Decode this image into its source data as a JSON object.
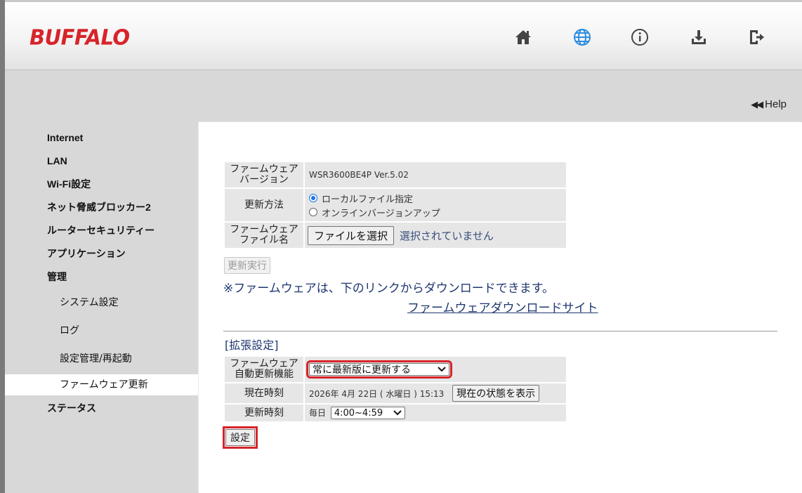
{
  "header": {
    "logo": "BUFFALO",
    "icons": [
      "home-icon",
      "globe-icon",
      "info-icon",
      "download-icon",
      "logout-icon"
    ],
    "accent_color": "#d7242a",
    "globe_color": "#2b8de0"
  },
  "help": {
    "arrows": "◀◀",
    "label": "Help"
  },
  "nav": {
    "internet": "Internet",
    "lan": "LAN",
    "wifi": "Wi-Fi設定",
    "net_blocker": "ネット脅威ブロッカー2",
    "router_security": "ルーターセキュリティー",
    "application": "アプリケーション",
    "admin": "管理",
    "system": "システム設定",
    "log": "ログ",
    "config_restart": "設定管理/再起動",
    "firmware_update": "ファームウェア更新",
    "status": "ステータス"
  },
  "firmware": {
    "version_label_1": "ファームウェア",
    "version_label_2": "バージョン",
    "version_value": "WSR3600BE4P Ver.5.02",
    "method_label": "更新方法",
    "method_local": "ローカルファイル指定",
    "method_online": "オンラインバージョンアップ",
    "file_label_1": "ファームウェア",
    "file_label_2": "ファイル名",
    "choose_file": "ファイルを選択",
    "no_file": "選択されていません",
    "execute": "更新実行",
    "note": "※ファームウェアは、下のリンクからダウンロードできます。",
    "download_link": "ファームウェアダウンロードサイト"
  },
  "advanced": {
    "title": "[拡張設定]",
    "auto_label_1": "ファームウェア",
    "auto_label_2": "自動更新機能",
    "auto_value": "常に最新版に更新する",
    "now_label": "現在時刻",
    "now_value": "2026年 4月 22日 ( 水曜日 )  15:13",
    "show_status": "現在の状態を表示",
    "update_time_label": "更新時刻",
    "every_day": "毎日",
    "time_value": "4:00~4:59",
    "apply": "設定"
  }
}
